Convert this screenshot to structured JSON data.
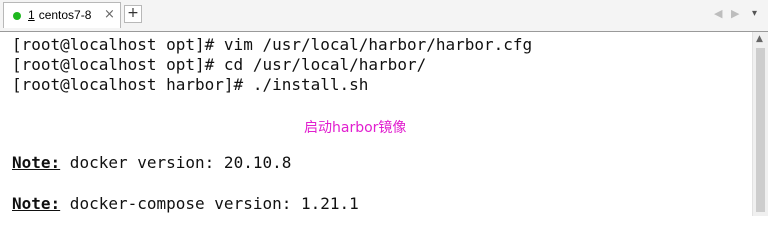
{
  "tab": {
    "number": "1",
    "title": "centos7-8",
    "close": "×",
    "status_color": "#1fb81f"
  },
  "tabbar": {
    "add": "+",
    "nav_left": "◀",
    "nav_right": "▶",
    "menu": "▾"
  },
  "terminal": {
    "lines": [
      "[root@localhost opt]# vim /usr/local/harbor/harbor.cfg",
      "[root@localhost opt]# cd /usr/local/harbor/",
      "[root@localhost harbor]# ./install.sh"
    ],
    "annotation": "启动harbor镜像",
    "notes": [
      {
        "label": "Note:",
        "text": " docker version: 20.10.8"
      },
      {
        "label": "Note:",
        "text": " docker-compose version: 1.21.1"
      }
    ]
  },
  "scrollbar": {
    "up": "▲"
  },
  "colors": {
    "annotation": "#e11fcf",
    "text": "#111111",
    "background": "#ffffff"
  }
}
